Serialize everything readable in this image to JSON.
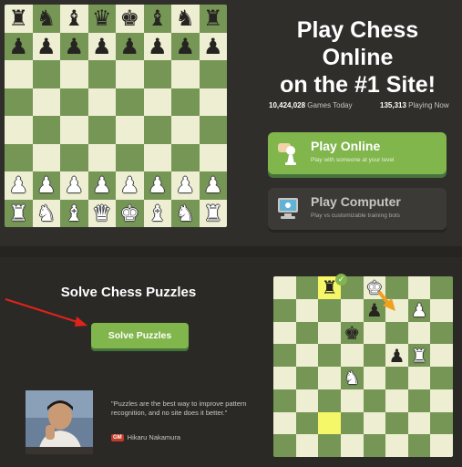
{
  "hero": {
    "title_line1": "Play Chess",
    "title_line2": "Online",
    "title_line3": "on the #1 Site!"
  },
  "stats": {
    "games_value": "10,424,028",
    "games_label": "Games Today",
    "playing_value": "135,313",
    "playing_label": "Playing Now"
  },
  "buttons": {
    "online_title": "Play Online",
    "online_sub": "Play with someone at your level",
    "online_icon": "hand-pawn-icon",
    "computer_title": "Play Computer",
    "computer_sub": "Play vs customizable training bots",
    "computer_icon": "computer-icon"
  },
  "puzzles": {
    "title": "Solve Chess Puzzles",
    "button_label": "Solve Puzzles",
    "quote": "\"Puzzles are the best way to improve pattern recognition, and no site does it better.\"",
    "gm_badge": "GM",
    "author": "Hikaru Nakamura"
  },
  "colors": {
    "accent_green": "#81b64c",
    "board_light": "#eeeed2",
    "board_dark": "#769656",
    "background": "#302e2b",
    "arrow_red": "#e0231a",
    "move_arrow_orange": "#f0a020"
  },
  "boards": {
    "main": [
      [
        "r",
        "n",
        "b",
        "q",
        "k",
        "b",
        "n",
        "r"
      ],
      [
        "p",
        "p",
        "p",
        "p",
        "p",
        "p",
        "p",
        "p"
      ],
      [
        "",
        "",
        "",
        "",
        "",
        "",
        "",
        ""
      ],
      [
        "",
        "",
        "",
        "",
        "",
        "",
        "",
        ""
      ],
      [
        "",
        "",
        "",
        "",
        "",
        "",
        "",
        ""
      ],
      [
        "",
        "",
        "",
        "",
        "",
        "",
        "",
        ""
      ],
      [
        "P",
        "P",
        "P",
        "P",
        "P",
        "P",
        "P",
        "P"
      ],
      [
        "R",
        "N",
        "B",
        "Q",
        "K",
        "B",
        "N",
        "R"
      ]
    ],
    "puzzle": [
      [
        "",
        "",
        "r",
        "",
        "K",
        "",
        "",
        ""
      ],
      [
        "",
        "",
        "",
        "",
        "p",
        "",
        "P",
        ""
      ],
      [
        "",
        "",
        "",
        "k",
        "",
        "",
        "",
        ""
      ],
      [
        "",
        "",
        "",
        "",
        "",
        "p",
        "R",
        ""
      ],
      [
        "",
        "",
        "",
        "N",
        "",
        "",
        "",
        ""
      ],
      [
        "",
        "",
        "",
        "",
        "",
        "",
        "",
        ""
      ],
      [
        "",
        "",
        "",
        "",
        "",
        "",
        "",
        ""
      ],
      [
        "",
        "",
        "",
        "",
        "",
        "",
        "",
        ""
      ]
    ],
    "puzzle_highlights": [
      "0-2",
      "6-2"
    ]
  }
}
